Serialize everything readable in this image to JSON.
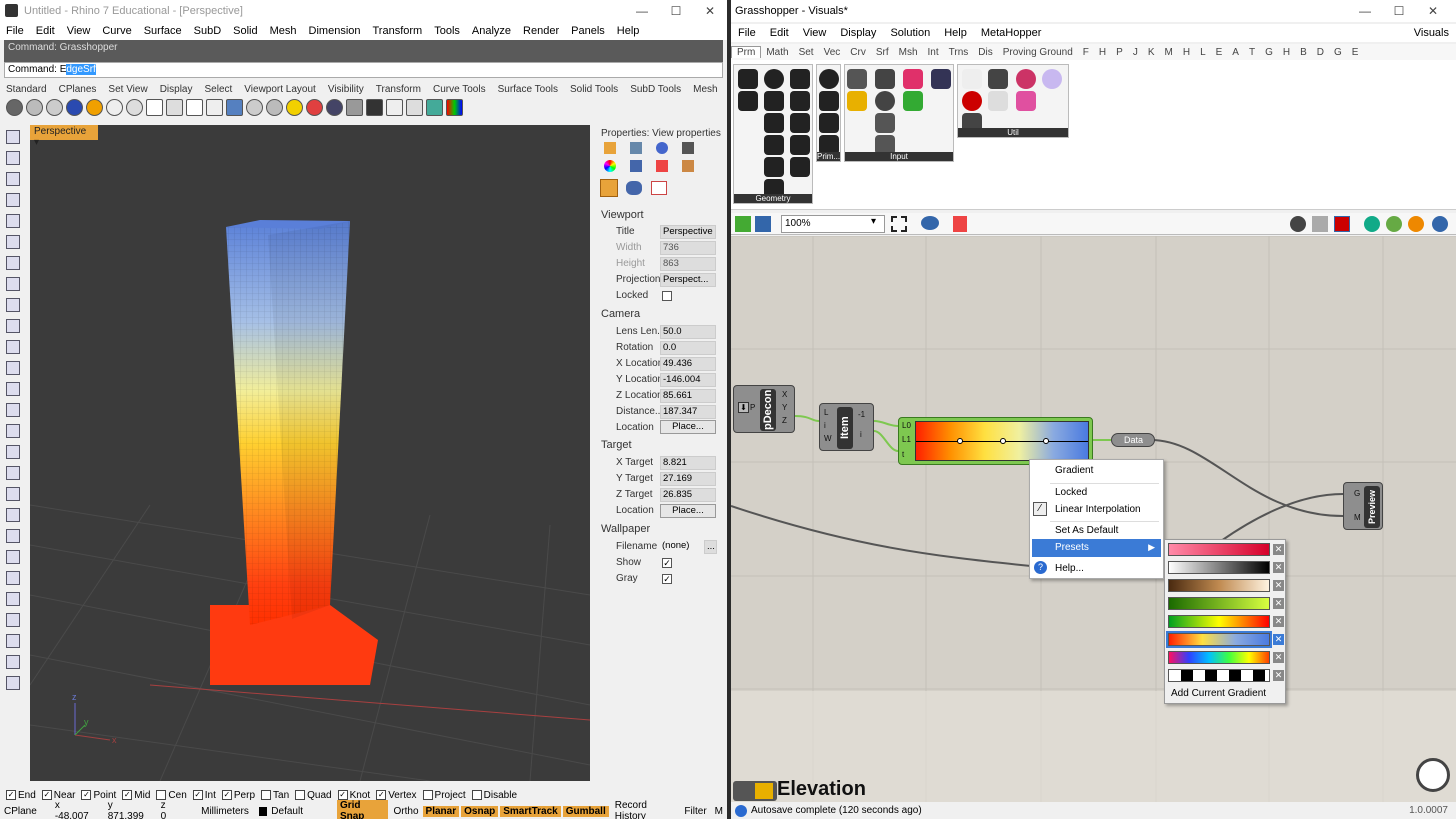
{
  "rhino": {
    "title": "Untitled - Rhino 7 Educational - [Perspective]",
    "window_controls": [
      "—",
      "☐",
      "✕"
    ],
    "menu": [
      "File",
      "Edit",
      "View",
      "Curve",
      "Surface",
      "SubD",
      "Solid",
      "Mesh",
      "Dimension",
      "Transform",
      "Tools",
      "Analyze",
      "Render",
      "Panels",
      "Help"
    ],
    "command_history": "Command: Grasshopper",
    "command_prefix": "Command: ",
    "command_first": "E",
    "command_value": "dgeSrf",
    "toolbar_tabs": [
      "Standard",
      "CPlanes",
      "Set View",
      "Display",
      "Select",
      "Viewport Layout",
      "Visibility",
      "Transform",
      "Curve Tools",
      "Surface Tools",
      "Solid Tools",
      "SubD Tools",
      "Mesh"
    ],
    "viewport_tab": "Perspective",
    "axis_labels": {
      "x": "x",
      "y": "y",
      "z": "z"
    },
    "properties": {
      "header": "Properties: View properties",
      "viewport_section": "Viewport",
      "title_label": "Title",
      "title_value": "Perspective",
      "width_label": "Width",
      "width_value": "736",
      "height_label": "Height",
      "height_value": "863",
      "projection_label": "Projection",
      "projection_value": "Perspect...",
      "locked_label": "Locked",
      "camera_section": "Camera",
      "lens_label": "Lens Len...",
      "lens_value": "50.0",
      "rotation_label": "Rotation",
      "rotation_value": "0.0",
      "xloc_label": "X Location",
      "xloc_value": "49.436",
      "yloc_label": "Y Location",
      "yloc_value": "-146.004",
      "zloc_label": "Z Location",
      "zloc_value": "85.661",
      "distance_label": "Distance...",
      "distance_value": "187.347",
      "location_label": "Location",
      "place_button": "Place...",
      "target_section": "Target",
      "xtarget_label": "X Target",
      "xtarget_value": "8.821",
      "ytarget_label": "Y Target",
      "ytarget_value": "27.169",
      "ztarget_label": "Z Target",
      "ztarget_value": "26.835",
      "target_location_label": "Location",
      "wallpaper_section": "Wallpaper",
      "filename_label": "Filename",
      "filename_value": "(none)",
      "browse_button": "...",
      "show_label": "Show",
      "gray_label": "Gray"
    },
    "osnaps": [
      {
        "label": "End",
        "checked": true
      },
      {
        "label": "Near",
        "checked": true
      },
      {
        "label": "Point",
        "checked": true
      },
      {
        "label": "Mid",
        "checked": true
      },
      {
        "label": "Cen",
        "checked": false
      },
      {
        "label": "Int",
        "checked": true
      },
      {
        "label": "Perp",
        "checked": true
      },
      {
        "label": "Tan",
        "checked": false
      },
      {
        "label": "Quad",
        "checked": false
      },
      {
        "label": "Knot",
        "checked": true
      },
      {
        "label": "Vertex",
        "checked": true
      },
      {
        "label": "Project",
        "checked": false
      },
      {
        "label": "Disable",
        "checked": false
      }
    ],
    "status": {
      "cplane": "CPlane",
      "x": "x -48.007",
      "y": "y 871.399",
      "z": "z 0",
      "units": "Millimeters",
      "layer": "Default",
      "panes": [
        "Grid Snap",
        "Ortho",
        "Planar",
        "Osnap",
        "SmartTrack",
        "Gumball",
        "Record History",
        "Filter",
        "M"
      ]
    }
  },
  "grasshopper": {
    "title": "Grasshopper - Visuals*",
    "title_right": "Visuals",
    "menu": [
      "File",
      "Edit",
      "View",
      "Display",
      "Solution",
      "Help",
      "MetaHopper"
    ],
    "tabs": [
      "Prm",
      "Math",
      "Set",
      "Vec",
      "Crv",
      "Srf",
      "Msh",
      "Int",
      "Trns",
      "Dis",
      "Proving Ground",
      "F",
      "H",
      "P",
      "J",
      "K",
      "M",
      "H",
      "L",
      "E",
      "A",
      "T",
      "G",
      "H",
      "B",
      "D",
      "G",
      "E"
    ],
    "groups": {
      "geometry": "Geometry",
      "primitive": "Prim...",
      "input": "Input",
      "util": "Util"
    },
    "zoom": "100%",
    "components": {
      "pdecon": "pDecon",
      "pdecon_in": "P",
      "pdecon_out": [
        "X",
        "Y",
        "Z"
      ],
      "item": "Item",
      "item_in": [
        "L",
        "i",
        "W"
      ],
      "item_out": [
        "-1",
        "i"
      ],
      "gradient_in": [
        "L0",
        "L1",
        "t"
      ],
      "data": "Data",
      "preview": "Preview",
      "preview_in": [
        "G",
        "M"
      ]
    },
    "context_menu": {
      "title": "Gradient",
      "locked": "Locked",
      "linear": "Linear Interpolation",
      "set_default": "Set As Default",
      "presets": "Presets",
      "help": "Help..."
    },
    "presets_menu": {
      "add": "Add Current Gradient",
      "gradients": [
        "linear-gradient(90deg,#ff8aa8,#d6002a)",
        "linear-gradient(90deg,#ffffff,#000000)",
        "linear-gradient(90deg,#4a2a10,#c08a50,#fff3e0)",
        "linear-gradient(90deg,#1a6a00,#d8ff40)",
        "linear-gradient(90deg,#00a020,#ffff00,#ff0000)",
        "linear-gradient(90deg,#ff2000,#ffe040,#8aaae0,#4a7ae0)",
        "linear-gradient(90deg,#ff1060,#3040ff,#00c0ff,#40ff40,#ffff00,#ff4000)",
        "repeating-linear-gradient(90deg,#fff 0 12px,#000 12px 24px)"
      ]
    },
    "bottom_label": "Elevation",
    "status": "Autosave complete (120 seconds ago)",
    "version": "1.0.0007"
  }
}
